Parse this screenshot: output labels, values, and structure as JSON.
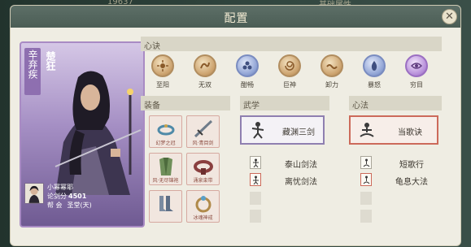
{
  "background": {
    "number_text": "19637",
    "right_text": "基础属性"
  },
  "dialog": {
    "title": "配置"
  },
  "character": {
    "name": "辛弃疾",
    "title": "楚狂",
    "player_name": "小幂幂耶",
    "power_label": "论剑分",
    "power_value": "4501",
    "guild_label": "帮 会",
    "guild_value": "圣堂(天)"
  },
  "sections": {
    "xinjue": "心诀",
    "equipment": "装备",
    "martial": "武学",
    "method": "心法"
  },
  "skills": [
    {
      "label": "至阳",
      "icon": "sun-emblem-icon",
      "color": "gold"
    },
    {
      "label": "无双",
      "icon": "dragon-emblem-icon",
      "color": "gold"
    },
    {
      "label": "酣畅",
      "icon": "flower-emblem-icon",
      "color": "blue"
    },
    {
      "label": "巨神",
      "icon": "swirl-emblem-icon",
      "color": "gold"
    },
    {
      "label": "卸力",
      "icon": "wave-emblem-icon",
      "color": "gold"
    },
    {
      "label": "暴怒",
      "icon": "flame-emblem-icon",
      "color": "blue"
    },
    {
      "label": "穷目",
      "icon": "eye-emblem-icon",
      "color": "purple"
    }
  ],
  "equipment": [
    {
      "label": "幻梦之冠",
      "icon": "crown-icon"
    },
    {
      "label": "风·青目剑",
      "icon": "sword-icon"
    },
    {
      "label": "风·无尽锦袍",
      "icon": "robe-icon"
    },
    {
      "label": "涌泉束带",
      "icon": "belt-icon"
    },
    {
      "label": "",
      "icon": "boots-icon"
    },
    {
      "label": "冰魂神戒",
      "icon": "ring-icon"
    }
  ],
  "martial": {
    "main": "藏渊三剑",
    "subs": [
      "泰山剑法",
      "离忧剑法"
    ]
  },
  "method": {
    "main": "当歌诀",
    "subs": [
      "短歌行",
      "龟息大法"
    ]
  }
}
